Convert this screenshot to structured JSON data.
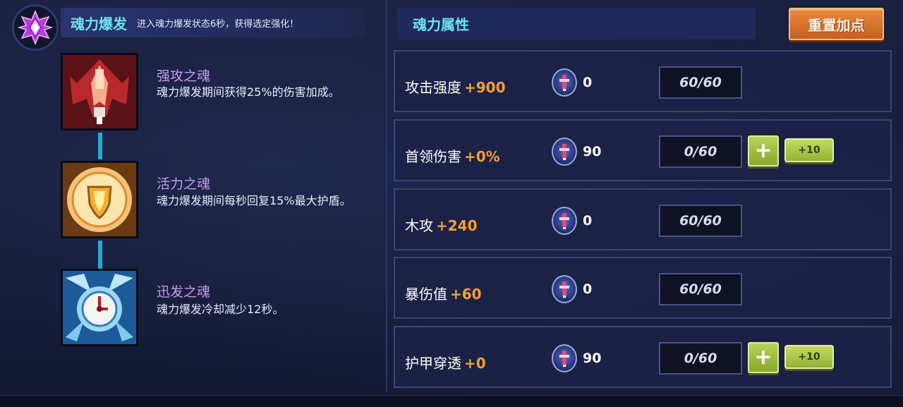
{
  "soul_burst": {
    "title": "魂力爆发",
    "description": "进入魂力爆发状态6秒，获得选定强化！",
    "icon": "purple-crystal-icon"
  },
  "souls": [
    {
      "name": "强攻之魂",
      "description": "魂力爆发期间获得25%的伤害加成。",
      "icon": "red-rocket-icon"
    },
    {
      "name": "活力之魂",
      "description": "魂力爆发期间每秒回复15%最大护盾。",
      "icon": "gold-shield-icon"
    },
    {
      "name": "迅发之魂",
      "description": "魂力爆发冷却减少12秒。",
      "icon": "blue-clock-icon"
    }
  ],
  "attributes_panel": {
    "title": "魂力属性",
    "reset_label": "重置加点"
  },
  "attributes": [
    {
      "name": "攻击强度",
      "bonus": "+900",
      "gem_count": "0",
      "level": "60/60",
      "can_add": false
    },
    {
      "name": "首领伤害",
      "bonus": "+0%",
      "gem_count": "90",
      "level": "0/60",
      "can_add": true,
      "plus_label": "+",
      "plus10_label": "+10"
    },
    {
      "name": "木攻",
      "bonus": "+240",
      "gem_count": "0",
      "level": "60/60",
      "can_add": false
    },
    {
      "name": "暴伤值",
      "bonus": "+60",
      "gem_count": "0",
      "level": "60/60",
      "can_add": false
    },
    {
      "name": "护甲穿透",
      "bonus": "+0",
      "gem_count": "90",
      "level": "0/60",
      "can_add": true,
      "plus_label": "+",
      "plus10_label": "+10"
    }
  ],
  "colors": {
    "accent_cyan": "#6fe3f0",
    "bonus_orange": "#f4a032",
    "soul_name_purple": "#c49cf0",
    "reset_orange": "#d9762e",
    "add_green": "#a8c84a"
  }
}
